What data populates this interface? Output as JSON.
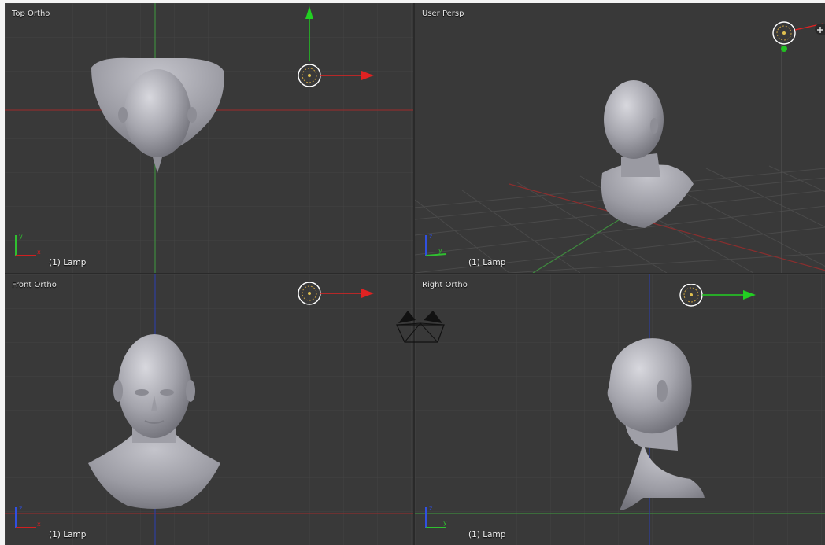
{
  "viewports": {
    "top_left": {
      "title": "Top Ortho",
      "object_label": "(1) Lamp",
      "axis_a": "x",
      "axis_b": "y"
    },
    "top_right": {
      "title": "User Persp",
      "object_label": "(1) Lamp",
      "axis_a": "y",
      "axis_b": "z"
    },
    "bottom_left": {
      "title": "Front Ortho",
      "object_label": "(1) Lamp",
      "axis_a": "x",
      "axis_b": "z"
    },
    "bottom_right": {
      "title": "Right Ortho",
      "object_label": "(1) Lamp",
      "axis_a": "y",
      "axis_b": "z"
    }
  },
  "colors": {
    "viewport_bg": "#393939",
    "grid": "#474747",
    "axis_x": "#8a2e2e",
    "axis_y": "#3f8a3f",
    "axis_z": "#2f3f9e",
    "mesh": "#a6a6ae",
    "manip_x": "#e02222",
    "manip_y": "#22d022"
  }
}
